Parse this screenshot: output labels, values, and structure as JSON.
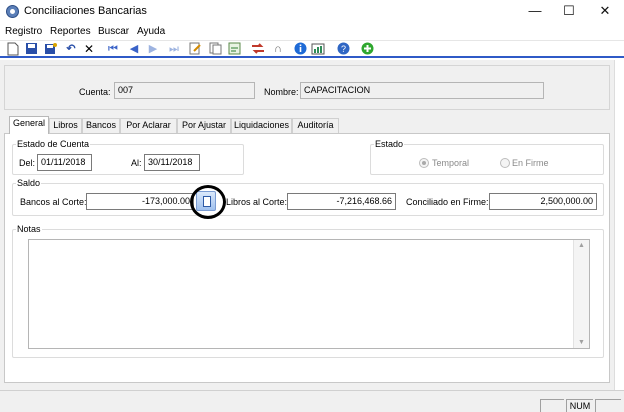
{
  "window": {
    "title": "Conciliaciones Bancarias",
    "controls": {
      "minimize": "—",
      "maximize": "☐",
      "close": "✕"
    }
  },
  "menu": [
    "Registro",
    "Reportes",
    "Buscar",
    "Ayuda"
  ],
  "toolbar": {
    "icons": [
      "new-icon",
      "save-icon",
      "save-as-icon",
      "undo-icon",
      "delete-icon",
      "first-record-icon",
      "previous-record-icon",
      "next-record-icon",
      "last-record-icon",
      "edit-icon",
      "copy-document-icon",
      "export-icon",
      "transfer-icon",
      "refresh-icon",
      "info-icon",
      "report-icon",
      "help-icon",
      "add-icon"
    ]
  },
  "header": {
    "cuenta_label": "Cuenta:",
    "cuenta_value": "007",
    "nombre_label": "Nombre:",
    "nombre_value": "CAPACITACION"
  },
  "tabs": [
    "General",
    "Libros",
    "Bancos",
    "Por Aclarar",
    "Por Ajustar",
    "Liquidaciones",
    "Auditoría"
  ],
  "active_tab": "General",
  "estado_cuenta": {
    "title": "Estado de Cuenta",
    "del_label": "Del:",
    "del_value": "01/11/2018",
    "al_label": "Al:",
    "al_value": "30/11/2018"
  },
  "estado": {
    "title": "Estado",
    "options": [
      "Temporal",
      "En Firme"
    ],
    "selected": "Temporal"
  },
  "saldo": {
    "title": "Saldo",
    "bancos_label": "Bancos al Corte:",
    "bancos_value": "-173,000.00",
    "libros_label": "Libros al Corte:",
    "libros_value": "-7,216,468.66",
    "conciliado_label": "Conciliado en Firme:",
    "conciliado_value": "2,500,000.00"
  },
  "notas": {
    "title": "Notas",
    "value": ""
  },
  "status": {
    "num": "NUM"
  }
}
